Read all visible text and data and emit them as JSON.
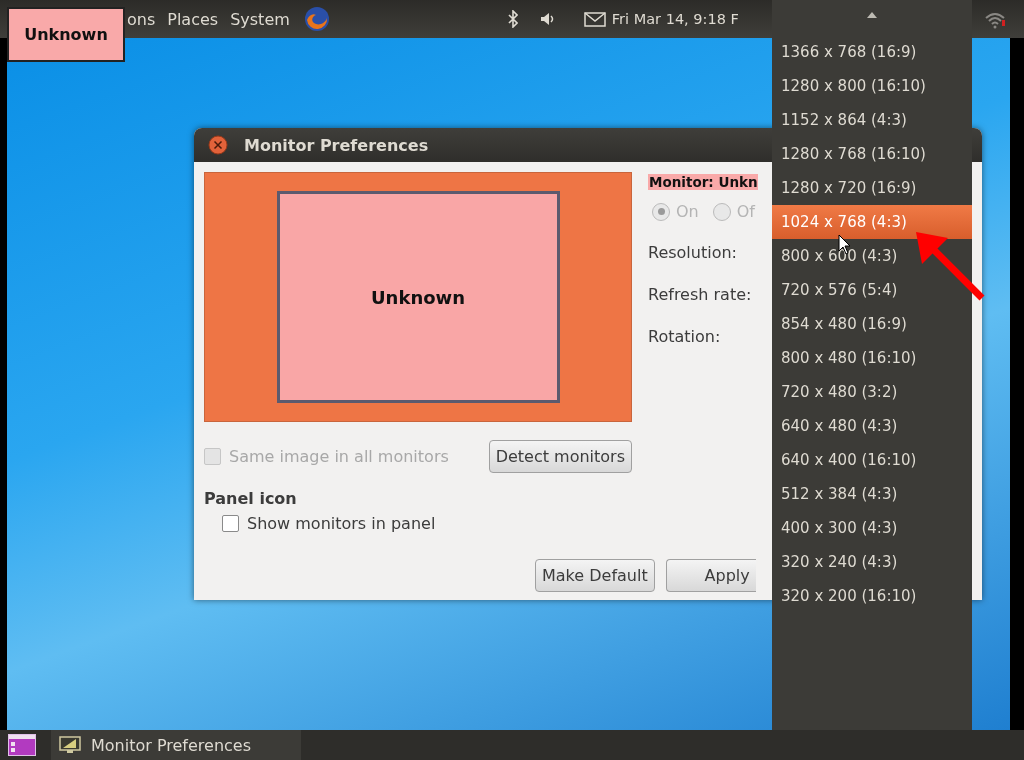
{
  "top_panel": {
    "menus": [
      "ons",
      "Places",
      "System"
    ],
    "clock": "Fri Mar 14, 9:18 F"
  },
  "monitor_label": "Unknown",
  "dialog": {
    "title": "Monitor Preferences",
    "monitor_name": "Unknown",
    "monitor_heading": "Monitor: Unkn",
    "power": [
      {
        "label": "On",
        "selected": true,
        "disabled": true
      },
      {
        "label": "Of",
        "selected": false,
        "disabled": true
      }
    ],
    "fields": [
      "Resolution:",
      "Refresh rate:",
      "Rotation:"
    ],
    "same_image": {
      "label": "Same image in all monitors",
      "checked": false,
      "disabled": true
    },
    "detect_button": "Detect monitors",
    "panel_icon_heading": "Panel icon",
    "show_in_panel": {
      "label": "Show monitors in panel",
      "checked": false,
      "disabled": false
    },
    "buttons": [
      "Make Default",
      "Apply"
    ]
  },
  "resolution_menu": {
    "items": [
      {
        "label": "1366 x 768 (16:9)",
        "selected": false
      },
      {
        "label": "1280 x 800 (16:10)",
        "selected": false
      },
      {
        "label": "1152 x 864 (4:3)",
        "selected": false
      },
      {
        "label": "1280 x 768 (16:10)",
        "selected": false
      },
      {
        "label": "1280 x 720 (16:9)",
        "selected": false
      },
      {
        "label": "1024 x 768 (4:3)",
        "selected": true
      },
      {
        "label": "800 x 600 (4:3)",
        "selected": false
      },
      {
        "label": "720 x 576 (5:4)",
        "selected": false
      },
      {
        "label": "854 x 480 (16:9)",
        "selected": false
      },
      {
        "label": "800 x 480 (16:10)",
        "selected": false
      },
      {
        "label": "720 x 480 (3:2)",
        "selected": false
      },
      {
        "label": "640 x 480 (4:3)",
        "selected": false
      },
      {
        "label": "640 x 400 (16:10)",
        "selected": false
      },
      {
        "label": "512 x 384 (4:3)",
        "selected": false
      },
      {
        "label": "400 x 300 (4:3)",
        "selected": false
      },
      {
        "label": "320 x 240 (4:3)",
        "selected": false
      },
      {
        "label": "320 x 200 (16:10)",
        "selected": false
      }
    ]
  },
  "taskbar": {
    "items": [
      {
        "label": "Monitor Preferences",
        "selected": false
      }
    ]
  }
}
